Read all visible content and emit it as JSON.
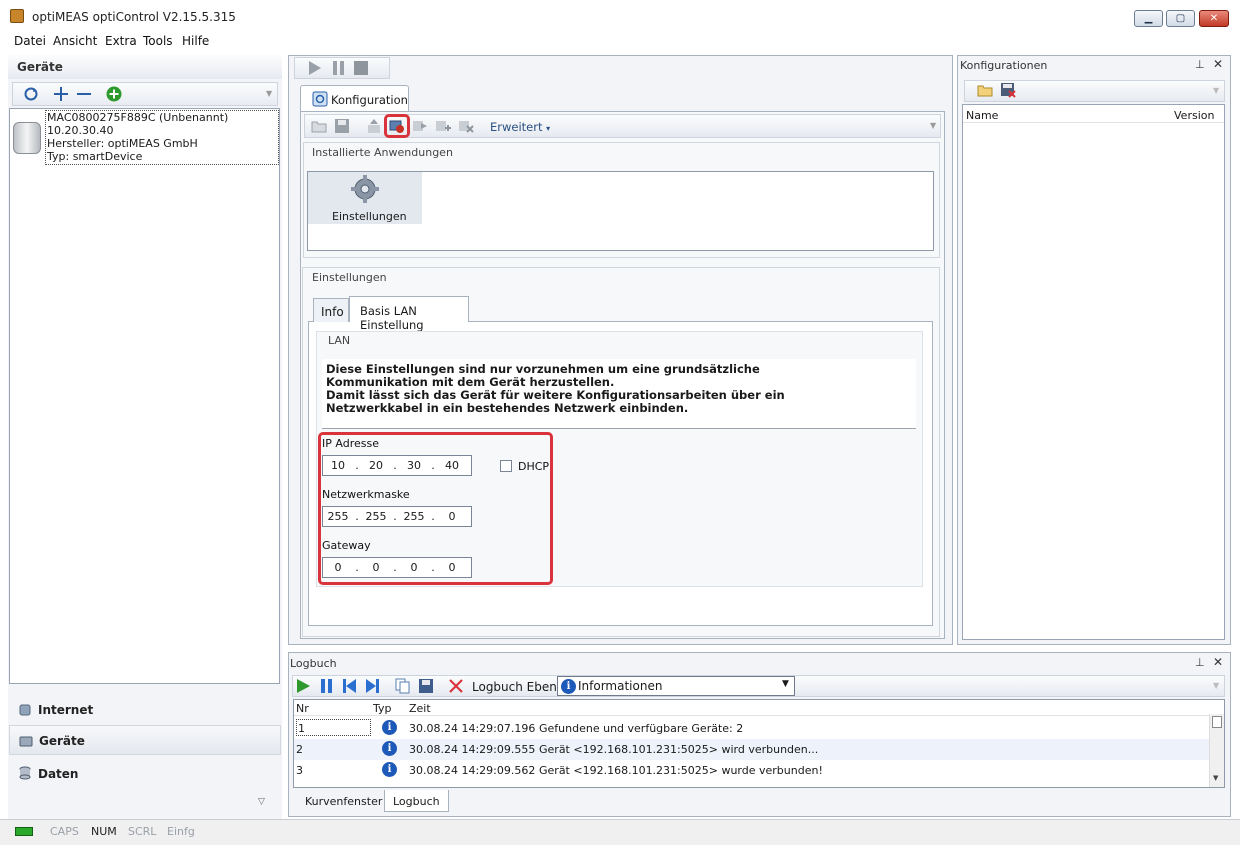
{
  "window": {
    "title": "optiMEAS optiControl V2.15.5.315"
  },
  "menu": [
    "Datei",
    "Ansicht",
    "Extra",
    "Tools",
    "Hilfe"
  ],
  "left": {
    "header": "Geräte",
    "device": {
      "name": "MAC0800275F889C (Unbenannt)",
      "ip": "10.20.30.40",
      "vendor": "Hersteller: optiMEAS GmbH",
      "type": "Typ: smartDevice"
    },
    "nav": [
      "Internet",
      "Geräte",
      "Daten"
    ]
  },
  "center": {
    "tab": "Konfiguration",
    "toolbar_more": "Erweitert",
    "installed_title": "Installierte Anwendungen",
    "app_tile": "Einstellungen",
    "settings_title": "Einstellungen",
    "inner_tabs": [
      "Info",
      "Basis LAN Einstellung"
    ],
    "lan_group": "LAN",
    "info_lines": [
      "Diese Einstellungen sind nur vorzunehmen um eine grundsätzliche",
      "Kommunikation mit dem Gerät herzustellen.",
      "Damit lässt sich das Gerät für weitere Konfigurationsarbeiten über ein",
      "Netzwerkkabel in ein bestehendes Netzwerk einbinden."
    ],
    "ip_label": "IP Adresse",
    "ip": [
      "10",
      "20",
      "30",
      "40"
    ],
    "dhcp_label": "DHCP",
    "dhcp_checked": false,
    "mask_label": "Netzwerkmaske",
    "mask": [
      "255",
      "255",
      "255",
      "0"
    ],
    "gateway_label": "Gateway",
    "gateway": [
      "0",
      "0",
      "0",
      "0"
    ]
  },
  "right": {
    "header": "Konfigurationen",
    "col_name": "Name",
    "col_version": "Version"
  },
  "log": {
    "header": "Logbuch",
    "level_label": "Logbuch Ebene",
    "level_value": "Informationen",
    "columns": [
      "Nr",
      "Typ",
      "Zeit"
    ],
    "rows": [
      {
        "nr": "1",
        "time": "30.08.24 14:29:07.196",
        "msg": "Gefundene und verfügbare Geräte: 2"
      },
      {
        "nr": "2",
        "time": "30.08.24 14:29:09.555",
        "msg": "Gerät <192.168.101.231:5025> wird verbunden..."
      },
      {
        "nr": "3",
        "time": "30.08.24 14:29:09.562",
        "msg": "Gerät <192.168.101.231:5025> wurde verbunden!"
      }
    ],
    "bottom_tabs": [
      "Kurvenfenster",
      "Logbuch"
    ]
  },
  "status": [
    "CAPS",
    "NUM",
    "SCRL",
    "Einfg"
  ],
  "colors": {
    "highlight": "#d9343c",
    "info_icon": "#1d59b8",
    "accent": "#2a5fa8"
  }
}
